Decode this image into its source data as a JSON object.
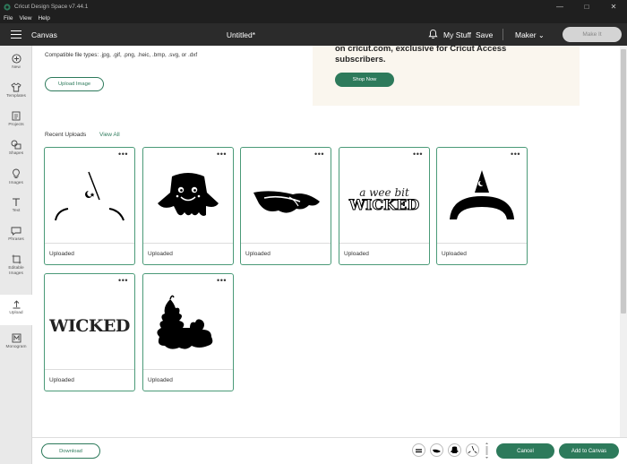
{
  "window": {
    "title": "Cricut Design Space  v7.44.1",
    "controls": [
      "minimize-icon",
      "maximize-icon",
      "close-icon"
    ]
  },
  "menu": [
    "File",
    "View",
    "Help"
  ],
  "header": {
    "canvas_label": "Canvas",
    "doc_title": "Untitled*",
    "my_stuff": "My Stuff",
    "save": "Save",
    "machine": "Maker",
    "make_it": "Make It"
  },
  "sidebar": {
    "items": [
      {
        "label": "New",
        "icon": "plus-circle-icon"
      },
      {
        "label": "Templates",
        "icon": "shirt-icon"
      },
      {
        "label": "Projects",
        "icon": "projects-icon"
      },
      {
        "label": "Shapes",
        "icon": "shapes-icon"
      },
      {
        "label": "Images",
        "icon": "bulb-icon"
      },
      {
        "label": "Text",
        "icon": "text-icon"
      },
      {
        "label": "Phrases",
        "icon": "speech-bubble-icon"
      },
      {
        "label": "Editable Images",
        "icon": "editable-images-icon"
      },
      {
        "label": "Upload",
        "icon": "upload-icon"
      },
      {
        "label": "Monogram",
        "icon": "monogram-icon"
      }
    ],
    "active": "Upload"
  },
  "upload": {
    "file_types": "Compatible file types: .jpg, .gif, .png, .heic, .bmp, .svg, or .dxf",
    "upload_button": "Upload Image"
  },
  "promo": {
    "text": "on cricut.com, exclusive for Cricut Access subscribers.",
    "button": "Shop Now"
  },
  "recent": {
    "title": "Recent Uploads",
    "view_all": "View All",
    "cards": [
      {
        "caption": "Uploaded",
        "thumb": "witch-moon-icon"
      },
      {
        "caption": "Uploaded",
        "thumb": "ghost-icon"
      },
      {
        "caption": "Uploaded",
        "thumb": "witch-hat-brim-icon"
      },
      {
        "caption": "Uploaded",
        "thumb": "a-wee-bit-wicked-text",
        "text1": "a wee bit",
        "text2": "WICKED"
      },
      {
        "caption": "Uploaded",
        "thumb": "witch-hat-icon"
      },
      {
        "caption": "Uploaded",
        "thumb": "wicked-text",
        "text1": "WICKED"
      },
      {
        "caption": "Uploaded",
        "thumb": "tree-silhouette-icon"
      }
    ],
    "more": "•••"
  },
  "footer": {
    "download": "Download",
    "cancel": "Cancel",
    "add_to_canvas": "Add to Canvas",
    "tray_items": [
      "a-wee-bit-wicked-text",
      "witch-hat-brim-icon",
      "ghost-icon",
      "witch-moon-icon"
    ]
  },
  "colors": {
    "accent": "#2d7a5b",
    "header_bg": "#2b2b2b",
    "title_bg": "#1f1f1f",
    "promo_bg": "#faf6ee"
  }
}
